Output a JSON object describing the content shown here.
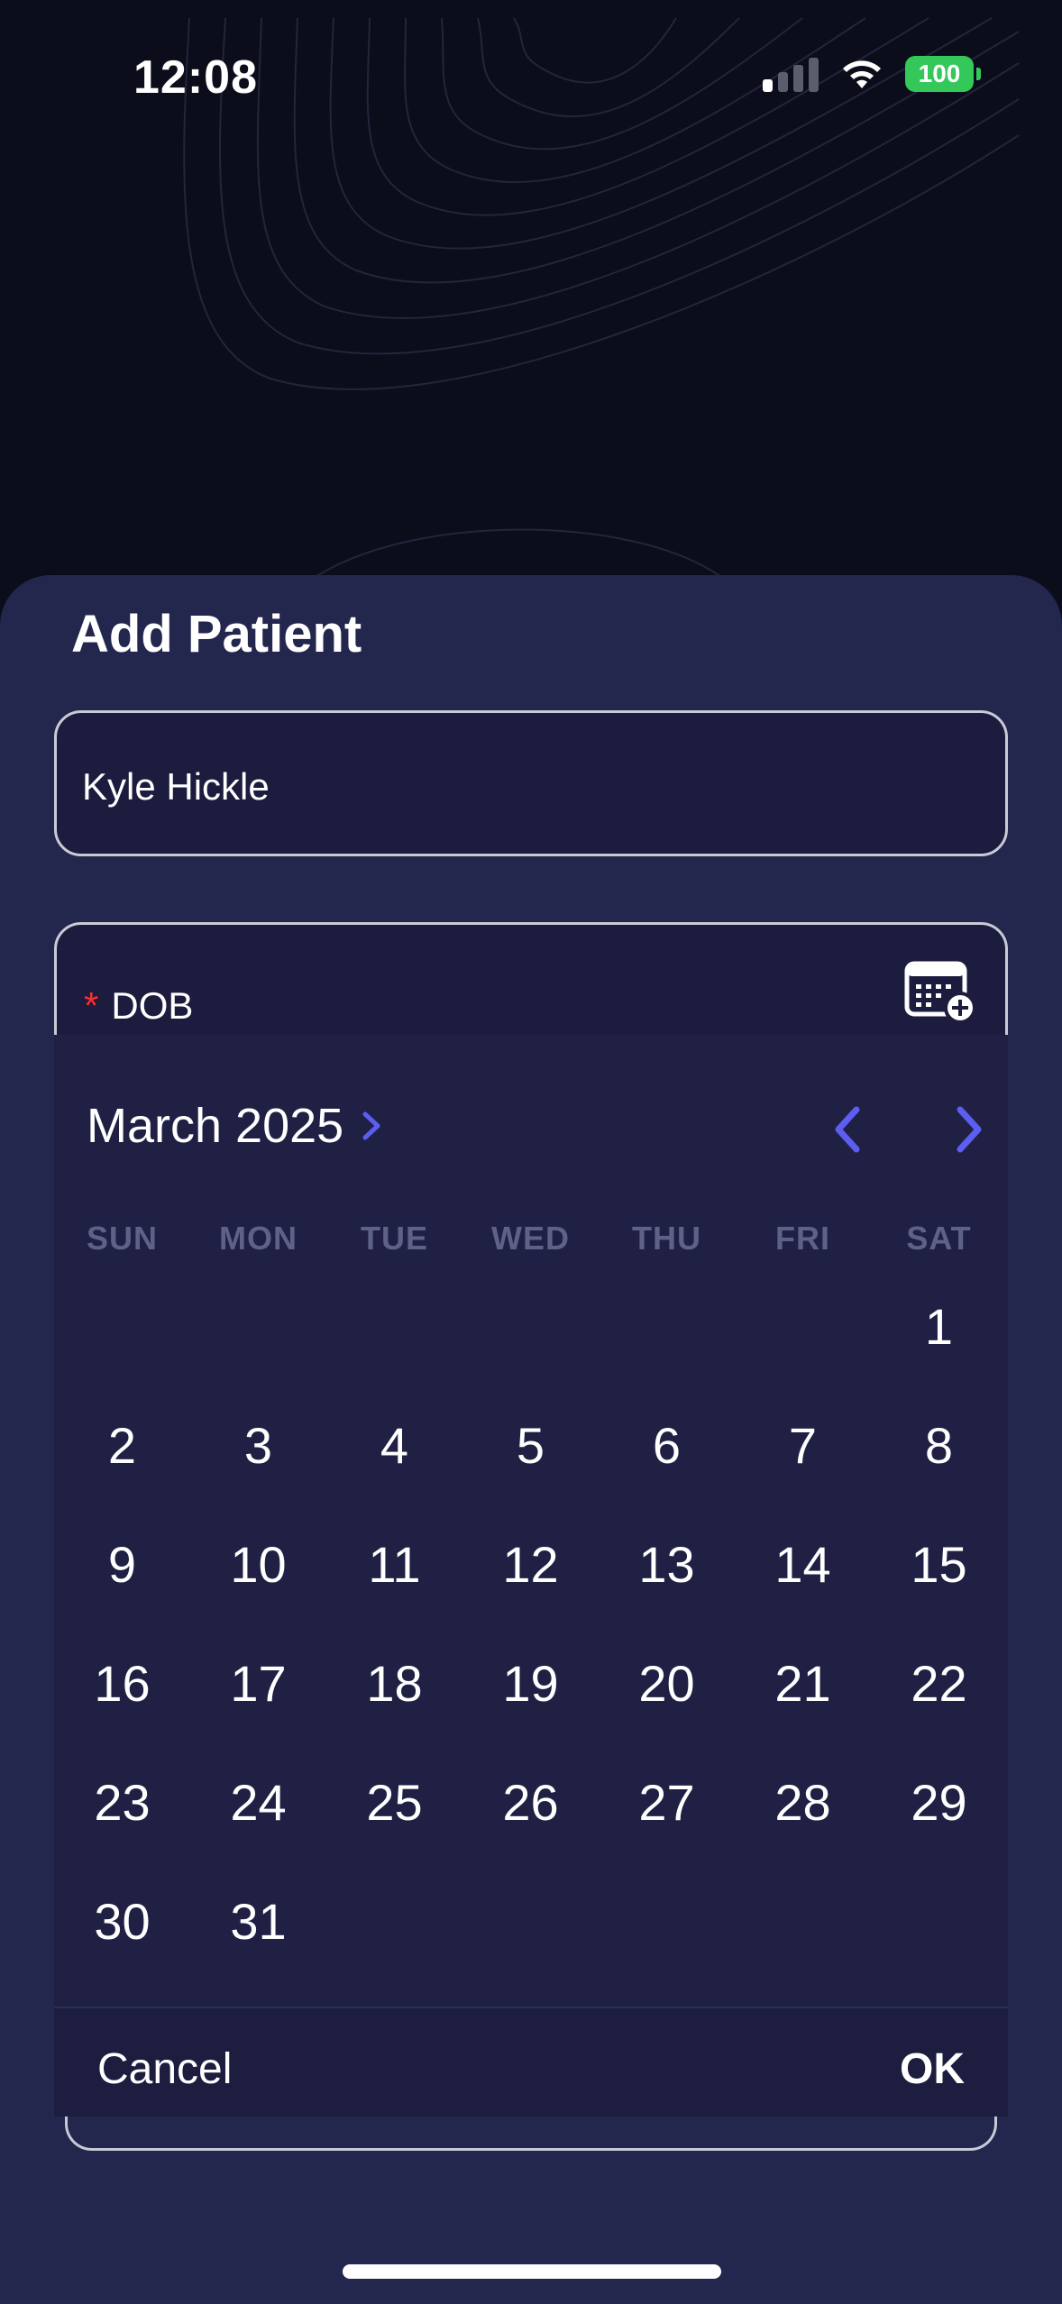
{
  "status_bar": {
    "time": "12:08",
    "battery": "100",
    "icons": [
      "cellular-signal-icon",
      "wifi-icon",
      "battery-icon"
    ]
  },
  "sheet": {
    "title": "Add Patient",
    "name_field": {
      "value": "Kyle Hickle"
    },
    "dob_field": {
      "required_marker": "*",
      "label": "DOB",
      "icon": "calendar-add-icon"
    }
  },
  "date_picker": {
    "month_label": "March 2025",
    "weekdays": [
      "SUN",
      "MON",
      "TUE",
      "WED",
      "THU",
      "FRI",
      "SAT"
    ],
    "leading_blanks": 6,
    "days": [
      "1",
      "2",
      "3",
      "4",
      "5",
      "6",
      "7",
      "8",
      "9",
      "10",
      "11",
      "12",
      "13",
      "14",
      "15",
      "16",
      "17",
      "18",
      "19",
      "20",
      "21",
      "22",
      "23",
      "24",
      "25",
      "26",
      "27",
      "28",
      "29",
      "30",
      "31"
    ],
    "cancel_label": "Cancel",
    "ok_label": "OK",
    "accent_color": "#5b5ef0"
  }
}
